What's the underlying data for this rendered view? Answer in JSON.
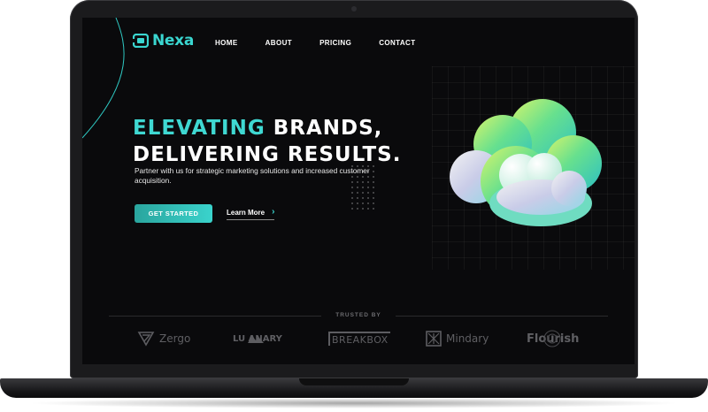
{
  "brand": {
    "name": "Nexa",
    "accent_color": "#3ad6d0"
  },
  "nav": {
    "items": [
      {
        "label": "HOME"
      },
      {
        "label": "ABOUT"
      },
      {
        "label": "PRICING"
      },
      {
        "label": "CONTACT"
      }
    ]
  },
  "hero": {
    "title_accent": "ELEVATING",
    "title_rest_line1": " BRANDS,",
    "title_line2": "DELIVERING RESULTS.",
    "subtitle": "Partner with us for strategic marketing solutions and increased customer acquisition.",
    "primary_button": "GET STARTED",
    "secondary_button": "Learn More",
    "secondary_icon": "chevron-right-icon",
    "illustration": "3d-gradient-cloud"
  },
  "trusted": {
    "label": "TRUSTED BY",
    "logos": [
      {
        "name": "Zergo",
        "icon": "zergo-logo-icon"
      },
      {
        "name": "LU ANARY",
        "icon": "mountain-logo-icon"
      },
      {
        "name": "BREAKBOX",
        "icon": "breakbox-logo-icon"
      },
      {
        "name": "Mindary",
        "icon": "mindary-logo-icon"
      },
      {
        "name": "Flourish",
        "icon": "flourish-logo-icon"
      }
    ]
  }
}
